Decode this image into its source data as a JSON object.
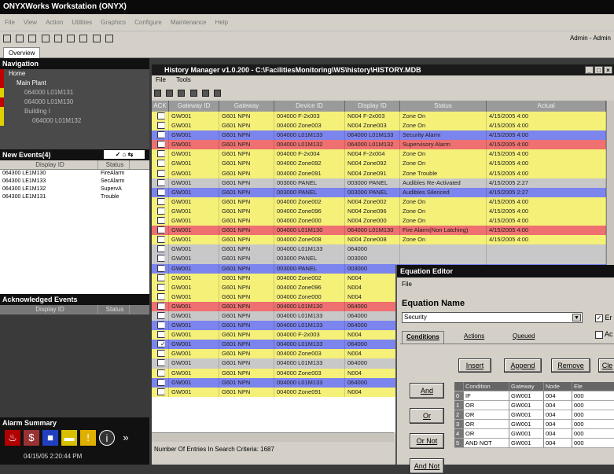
{
  "app": {
    "title": "ONYXWorks Workstation (ONYX)"
  },
  "menubar": [
    "File",
    "View",
    "Action",
    "Utilities",
    "Graphics",
    "Configure",
    "Maintenance",
    "Help"
  ],
  "admin_label": "Admin - Admin",
  "tabs": {
    "overview": "Overview"
  },
  "navigation": {
    "title": "Navigation",
    "items": [
      {
        "label": "Home",
        "indent": 0,
        "color": "#c00000"
      },
      {
        "label": "Main Plant",
        "indent": 1,
        "color": "#c00000"
      },
      {
        "label": "064000 L01M131",
        "indent": 2,
        "color": "#e0d000"
      },
      {
        "label": "064000 L01M130",
        "indent": 2,
        "color": "#c00000"
      },
      {
        "label": "Building I",
        "indent": 2,
        "color": "#e0d000"
      },
      {
        "label": "064000 L01M132",
        "indent": 3,
        "color": "#e0d000"
      }
    ]
  },
  "new_events": {
    "title": "New Events(4)",
    "columns": [
      "Display ID",
      "Status"
    ],
    "rows": [
      [
        "064300 LE1M130",
        "FireAlarm"
      ],
      [
        "064300 LE1M133",
        "SecAlarm"
      ],
      [
        "064300 LE1M132",
        "SupervA"
      ],
      [
        "064300 LE1M131",
        "Trouble"
      ]
    ]
  },
  "ack_events": {
    "title": "Acknowledged Events",
    "columns": [
      "Display ID",
      "Status"
    ]
  },
  "alarm_summary": {
    "title": "Alarm Summary",
    "timestamp": "04/15/05 2:20:44 PM"
  },
  "history": {
    "title": "History Manager v1.0.200 - C:\\FacilitiesMonitoring\\WS\\history\\HISTORY.MDB",
    "menu": [
      "File",
      "Tools"
    ],
    "columns": [
      "ACK",
      "Gateway ID",
      "Gateway",
      "Device ID",
      "Display ID",
      "Status",
      "Actual"
    ],
    "rows": [
      {
        "color": "#f5f078",
        "checked": false,
        "gid": "GW001",
        "gw": "G601 NPN",
        "dev": "004000 F-2x003",
        "disp": "N004 F-2x003",
        "status": "Zone On",
        "actual": "4/15/2005 4:00"
      },
      {
        "color": "#f5f078",
        "checked": false,
        "gid": "GW001",
        "gw": "G601 NPN",
        "dev": "004000 Zone003",
        "disp": "N004 Zone003",
        "status": "Zone On",
        "actual": "4/15/2005 4:00"
      },
      {
        "color": "#7c84ee",
        "checked": false,
        "gid": "GW001",
        "gw": "G601 NPN",
        "dev": "004000 L01M133",
        "disp": "064000 L01M133",
        "status": "Security Alarm",
        "actual": "4/15/2005 4:00"
      },
      {
        "color": "#ee7070",
        "checked": false,
        "gid": "GW001",
        "gw": "G601 NPN",
        "dev": "004000 L01M132",
        "disp": "064000 L01M132",
        "status": "Supervisory Alarm",
        "actual": "4/15/2005 4:00"
      },
      {
        "color": "#f5f078",
        "checked": false,
        "gid": "GW001",
        "gw": "G601 NPN",
        "dev": "004000 F-2x004",
        "disp": "N004 F-2x004",
        "status": "Zone On",
        "actual": "4/15/2005 4:00"
      },
      {
        "color": "#f5f078",
        "checked": false,
        "gid": "GW001",
        "gw": "G601 NPN",
        "dev": "004000 Zone092",
        "disp": "N004 Zone092",
        "status": "Zone On",
        "actual": "4/15/2005 4:00"
      },
      {
        "color": "#f5f078",
        "checked": false,
        "gid": "GW001",
        "gw": "G601 NPN",
        "dev": "004000 Zone091",
        "disp": "N004 Zone091",
        "status": "Zone Trouble",
        "actual": "4/15/2005 4:00"
      },
      {
        "color": "#c8c8c8",
        "checked": false,
        "gid": "GW001",
        "gw": "G601 NPN",
        "dev": "003000 PANEL",
        "disp": "003000 PANEL",
        "status": "Audibles Re-Activated",
        "actual": "4/15/2005 2:27"
      },
      {
        "color": "#7c84ee",
        "checked": false,
        "gid": "GW001",
        "gw": "G601 NPN",
        "dev": "003000 PANEL",
        "disp": "003000 PANEL",
        "status": "Audibles Silenced",
        "actual": "4/15/2005 2:27"
      },
      {
        "color": "#f5f078",
        "checked": false,
        "gid": "GW001",
        "gw": "G601 NPN",
        "dev": "004000 Zone002",
        "disp": "N004 Zone002",
        "status": "Zone On",
        "actual": "4/15/2005 4:00"
      },
      {
        "color": "#f5f078",
        "checked": false,
        "gid": "GW001",
        "gw": "G601 NPN",
        "dev": "004000 Zone096",
        "disp": "N004 Zone096",
        "status": "Zone On",
        "actual": "4/15/2005 4:00"
      },
      {
        "color": "#f5f078",
        "checked": false,
        "gid": "GW001",
        "gw": "G601 NPN",
        "dev": "004000 Zone000",
        "disp": "N004 Zone000",
        "status": "Zone On",
        "actual": "4/15/2005 4:00"
      },
      {
        "color": "#ee7070",
        "checked": false,
        "gid": "GW001",
        "gw": "G601 NPN",
        "dev": "004000 L01M130",
        "disp": "064000 L01M130",
        "status": "Fire Alarm(Non Latching)",
        "actual": "4/15/2005 4:00"
      },
      {
        "color": "#f5f078",
        "checked": false,
        "gid": "GW001",
        "gw": "G601 NPN",
        "dev": "004000 Zone008",
        "disp": "N004 Zone008",
        "status": "Zone On",
        "actual": "4/15/2005 4:00"
      },
      {
        "color": "#c8c8c8",
        "checked": false,
        "gid": "GW001",
        "gw": "G601 NPN",
        "dev": "004000 L01M133",
        "disp": "064000",
        "status": "",
        "actual": ""
      },
      {
        "color": "#c8c8c8",
        "checked": false,
        "gid": "GW001",
        "gw": "G601 NPN",
        "dev": "003000 PANEL",
        "disp": "003000",
        "status": "",
        "actual": ""
      },
      {
        "color": "#7c84ee",
        "checked": false,
        "gid": "GW001",
        "gw": "G601 NPN",
        "dev": "003000 PANEL",
        "disp": "003000",
        "status": "",
        "actual": ""
      },
      {
        "color": "#f5f078",
        "checked": false,
        "gid": "GW001",
        "gw": "G601 NPN",
        "dev": "004000 Zone002",
        "disp": "N004",
        "status": "",
        "actual": ""
      },
      {
        "color": "#f5f078",
        "checked": false,
        "gid": "GW001",
        "gw": "G601 NPN",
        "dev": "004000 Zone096",
        "disp": "N004",
        "status": "",
        "actual": ""
      },
      {
        "color": "#f5f078",
        "checked": false,
        "gid": "GW001",
        "gw": "G601 NPN",
        "dev": "004000 Zone000",
        "disp": "N004",
        "status": "",
        "actual": ""
      },
      {
        "color": "#ee7070",
        "checked": false,
        "gid": "GW001",
        "gw": "G601 NPN",
        "dev": "004000 L01M130",
        "disp": "064000",
        "status": "",
        "actual": ""
      },
      {
        "color": "#c8c8c8",
        "checked": false,
        "gid": "GW001",
        "gw": "G601 NPN",
        "dev": "004000 L01M133",
        "disp": "064000",
        "status": "",
        "actual": ""
      },
      {
        "color": "#7c84ee",
        "checked": false,
        "gid": "GW001",
        "gw": "G601 NPN",
        "dev": "004000 L01M133",
        "disp": "064000",
        "status": "",
        "actual": ""
      },
      {
        "color": "#f5f078",
        "checked": false,
        "gid": "GW001",
        "gw": "G601 NPN",
        "dev": "004000 F-2x003",
        "disp": "N004",
        "status": "",
        "actual": ""
      },
      {
        "color": "#7c84ee",
        "checked": true,
        "gid": "GW001",
        "gw": "G601 NPN",
        "dev": "004000 L01M133",
        "disp": "064000",
        "status": "",
        "actual": ""
      },
      {
        "color": "#f5f078",
        "checked": false,
        "gid": "GW001",
        "gw": "G601 NPN",
        "dev": "004000 Zone003",
        "disp": "N004",
        "status": "",
        "actual": ""
      },
      {
        "color": "#c8c8c8",
        "checked": false,
        "gid": "GW001",
        "gw": "G601 NPN",
        "dev": "004000 L01M133",
        "disp": "064000",
        "status": "",
        "actual": ""
      },
      {
        "color": "#f5f078",
        "checked": false,
        "gid": "GW001",
        "gw": "G601 NPN",
        "dev": "004000 Zone003",
        "disp": "N004",
        "status": "",
        "actual": ""
      },
      {
        "color": "#7c84ee",
        "checked": false,
        "gid": "GW001",
        "gw": "G601 NPN",
        "dev": "004000 L01M133",
        "disp": "064000",
        "status": "",
        "actual": ""
      },
      {
        "color": "#f5f078",
        "checked": false,
        "gid": "GW001",
        "gw": "G601 NPN",
        "dev": "004000 Zone091",
        "disp": "N004",
        "status": "",
        "actual": ""
      }
    ],
    "status_bar": "Number Of Entries In Search Criteria: 1687"
  },
  "equation_editor": {
    "title": "Equation Editor",
    "file_menu": "File",
    "name_label": "Equation Name",
    "name_value": "Security",
    "check1": "Er",
    "check2": "Ac",
    "tabs": [
      "Conditions",
      "Actions",
      "Queued"
    ],
    "buttons": {
      "insert": "Insert",
      "append": "Append",
      "remove": "Remove",
      "clear": "Cle"
    },
    "side_buttons": [
      "And",
      "Or",
      "Or Not",
      "And Not"
    ],
    "columns": [
      "",
      "Condition",
      "Gateway",
      "Node",
      "Ele"
    ],
    "rows": [
      [
        "0",
        "IF",
        "GW001",
        "004",
        "000"
      ],
      [
        "1",
        "OR",
        "GW001",
        "004",
        "000"
      ],
      [
        "2",
        "OR",
        "GW001",
        "004",
        "000"
      ],
      [
        "3",
        "OR",
        "GW001",
        "004",
        "000"
      ],
      [
        "4",
        "OR",
        "GW001",
        "004",
        "000"
      ],
      [
        "5",
        "AND NOT",
        "GW001",
        "004",
        "000"
      ]
    ]
  }
}
